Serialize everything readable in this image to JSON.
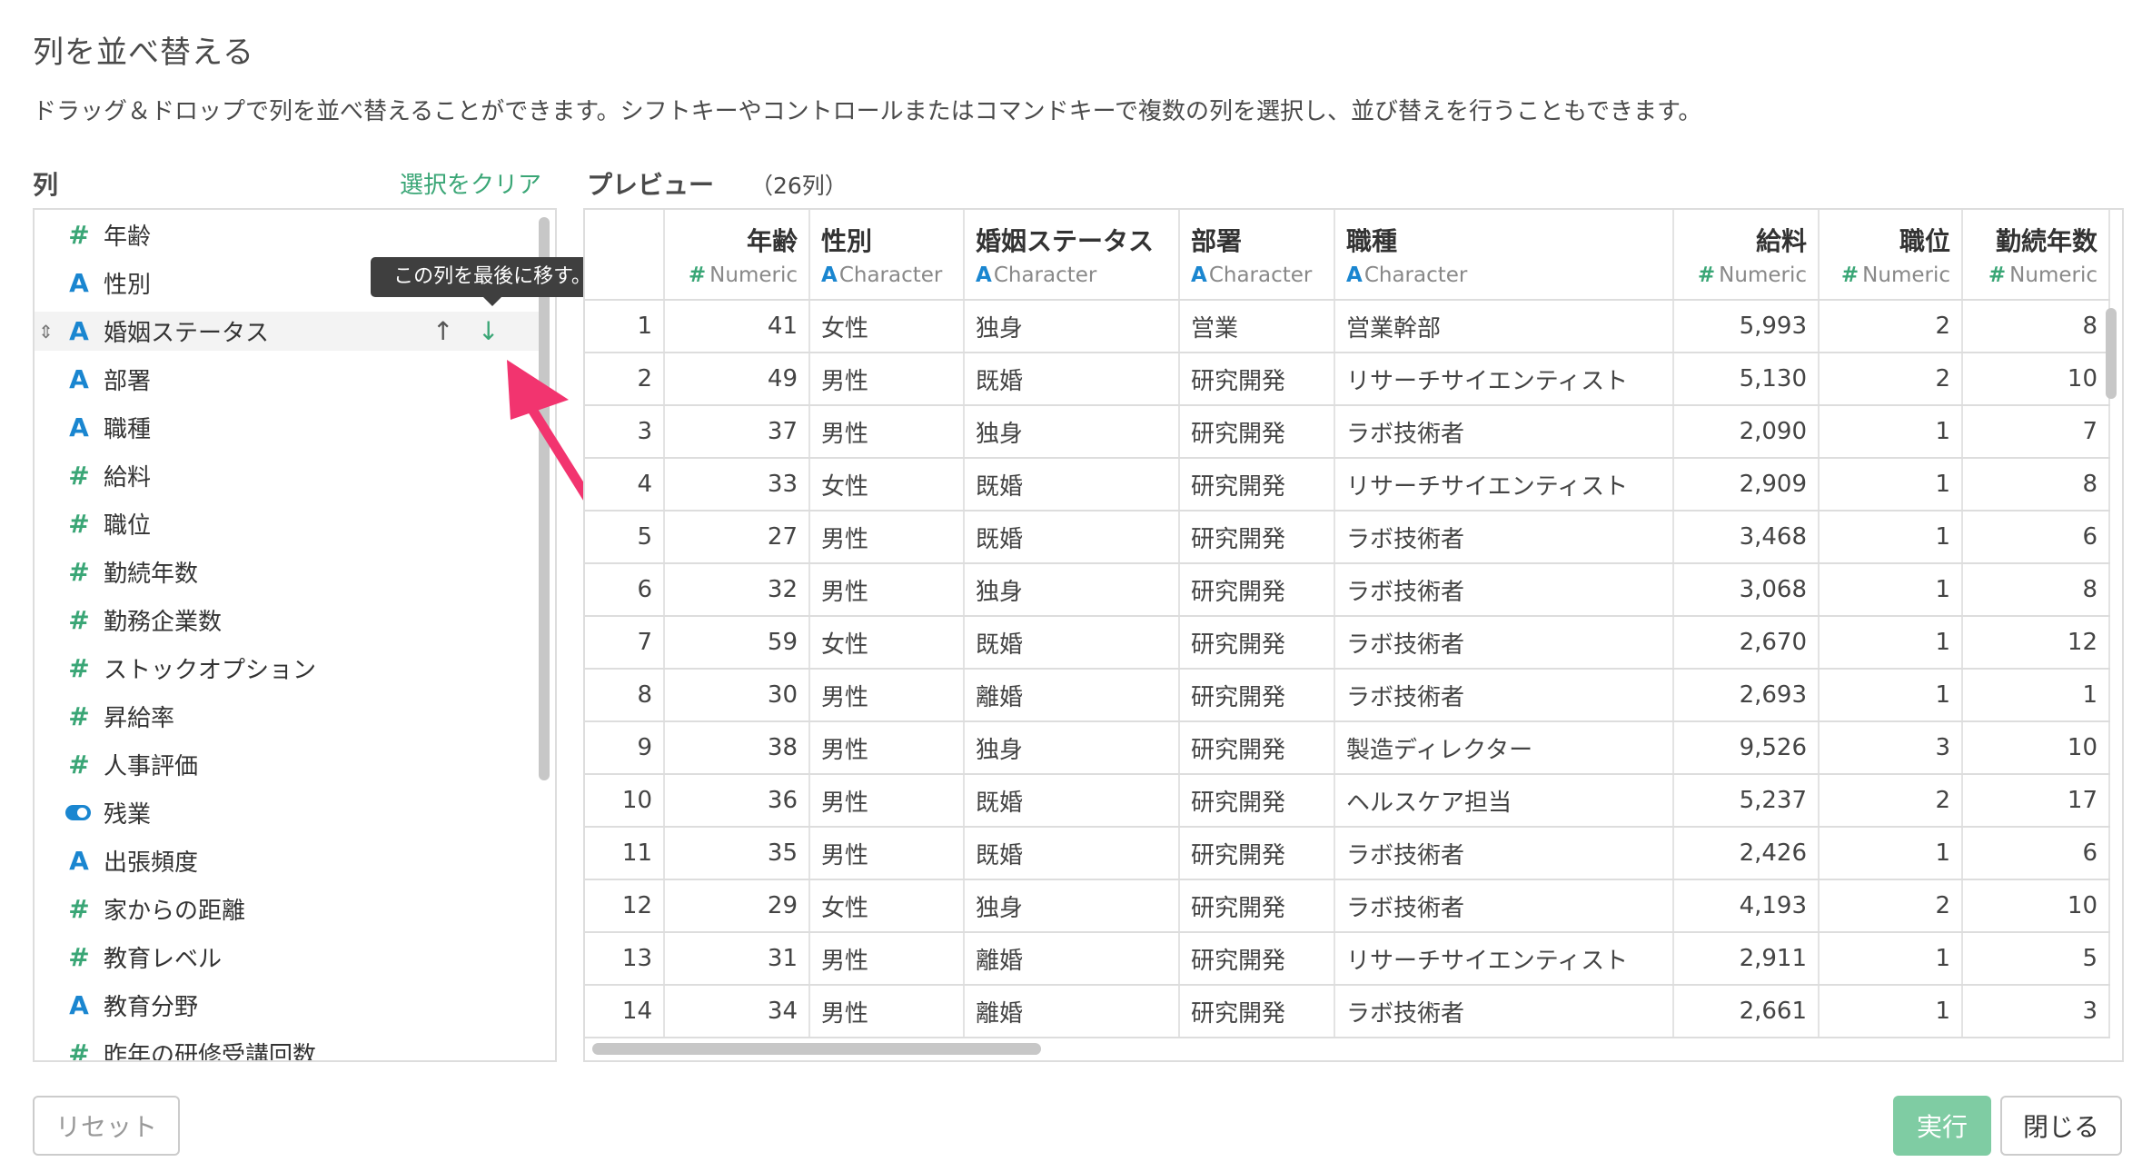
{
  "dialog": {
    "title": "列を並べ替える",
    "description": "ドラッグ＆ドロップで列を並べ替えることができます。シフトキーやコントロールまたはコマンドキーで複数の列を選択し、並び替えを行うこともできます。"
  },
  "columns_panel": {
    "label": "列",
    "clear_link": "選択をクリア",
    "tooltip": "この列を最後に移す。",
    "items": [
      {
        "name": "年齢",
        "type": "numeric"
      },
      {
        "name": "性別",
        "type": "character"
      },
      {
        "name": "婚姻ステータス",
        "type": "character",
        "highlighted": true
      },
      {
        "name": "部署",
        "type": "character"
      },
      {
        "name": "職種",
        "type": "character"
      },
      {
        "name": "給料",
        "type": "numeric"
      },
      {
        "name": "職位",
        "type": "numeric"
      },
      {
        "name": "勤続年数",
        "type": "numeric"
      },
      {
        "name": "勤務企業数",
        "type": "numeric"
      },
      {
        "name": "ストックオプション",
        "type": "numeric"
      },
      {
        "name": "昇給率",
        "type": "numeric"
      },
      {
        "name": "人事評価",
        "type": "numeric"
      },
      {
        "name": "残業",
        "type": "logical"
      },
      {
        "name": "出張頻度",
        "type": "character"
      },
      {
        "name": "家からの距離",
        "type": "numeric"
      },
      {
        "name": "教育レベル",
        "type": "numeric"
      },
      {
        "name": "教育分野",
        "type": "character"
      },
      {
        "name": "昨年の研修受講回数",
        "type": "numeric"
      }
    ]
  },
  "preview": {
    "label": "プレビュー",
    "count": "（26列）",
    "headers": [
      {
        "name": "年齢",
        "type": "Numeric"
      },
      {
        "name": "性別",
        "type": "Character"
      },
      {
        "name": "婚姻ステータス",
        "type": "Character"
      },
      {
        "name": "部署",
        "type": "Character"
      },
      {
        "name": "職種",
        "type": "Character"
      },
      {
        "name": "給料",
        "type": "Numeric"
      },
      {
        "name": "職位",
        "type": "Numeric"
      },
      {
        "name": "勤続年数",
        "type": "Numeric"
      }
    ],
    "rows": [
      [
        "1",
        "41",
        "女性",
        "独身",
        "営業",
        "営業幹部",
        "5,993",
        "2",
        "8"
      ],
      [
        "2",
        "49",
        "男性",
        "既婚",
        "研究開発",
        "リサーチサイエンティスト",
        "5,130",
        "2",
        "10"
      ],
      [
        "3",
        "37",
        "男性",
        "独身",
        "研究開発",
        "ラボ技術者",
        "2,090",
        "1",
        "7"
      ],
      [
        "4",
        "33",
        "女性",
        "既婚",
        "研究開発",
        "リサーチサイエンティスト",
        "2,909",
        "1",
        "8"
      ],
      [
        "5",
        "27",
        "男性",
        "既婚",
        "研究開発",
        "ラボ技術者",
        "3,468",
        "1",
        "6"
      ],
      [
        "6",
        "32",
        "男性",
        "独身",
        "研究開発",
        "ラボ技術者",
        "3,068",
        "1",
        "8"
      ],
      [
        "7",
        "59",
        "女性",
        "既婚",
        "研究開発",
        "ラボ技術者",
        "2,670",
        "1",
        "12"
      ],
      [
        "8",
        "30",
        "男性",
        "離婚",
        "研究開発",
        "ラボ技術者",
        "2,693",
        "1",
        "1"
      ],
      [
        "9",
        "38",
        "男性",
        "独身",
        "研究開発",
        "製造ディレクター",
        "9,526",
        "3",
        "10"
      ],
      [
        "10",
        "36",
        "男性",
        "既婚",
        "研究開発",
        "ヘルスケア担当",
        "5,237",
        "2",
        "17"
      ],
      [
        "11",
        "35",
        "男性",
        "既婚",
        "研究開発",
        "ラボ技術者",
        "2,426",
        "1",
        "6"
      ],
      [
        "12",
        "29",
        "女性",
        "独身",
        "研究開発",
        "ラボ技術者",
        "4,193",
        "2",
        "10"
      ],
      [
        "13",
        "31",
        "男性",
        "離婚",
        "研究開発",
        "リサーチサイエンティスト",
        "2,911",
        "1",
        "5"
      ],
      [
        "14",
        "34",
        "男性",
        "離婚",
        "研究開発",
        "ラボ技術者",
        "2,661",
        "1",
        "3"
      ]
    ]
  },
  "footer": {
    "reset_label": "リセット",
    "run_label": "実行",
    "close_label": "閉じる"
  },
  "colors": {
    "numeric_icon": "#3aa676",
    "character_icon": "#1a86d0",
    "run_button": "#7fcca3",
    "link": "#3aa676"
  }
}
